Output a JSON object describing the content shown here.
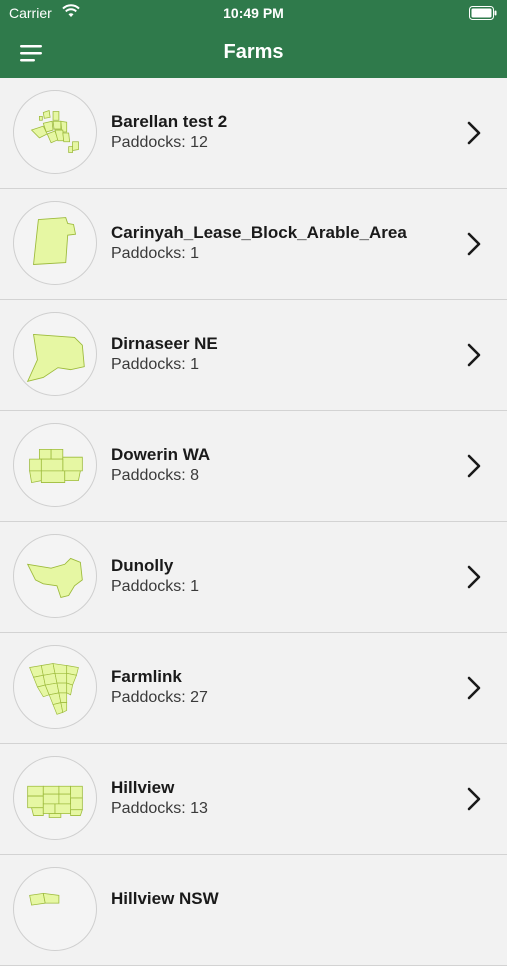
{
  "status_bar": {
    "carrier": "Carrier",
    "time": "10:49 PM",
    "icons": [
      "wifi-icon",
      "battery-icon"
    ]
  },
  "nav": {
    "title": "Farms",
    "menu_icon": "hamburger-menu-icon"
  },
  "colors": {
    "header": "#2f7a4b",
    "paddock_fill": "#e6f7a3",
    "paddock_stroke": "#9dbb3c"
  },
  "farms": [
    {
      "name": "Barellan test 2",
      "paddocks": "Paddocks: 12"
    },
    {
      "name": "Carinyah_Lease_Block_Arable_Area",
      "paddocks": "Paddocks: 1"
    },
    {
      "name": "Dirnaseer NE",
      "paddocks": "Paddocks: 1"
    },
    {
      "name": "Dowerin WA",
      "paddocks": "Paddocks: 8"
    },
    {
      "name": "Dunolly",
      "paddocks": "Paddocks: 1"
    },
    {
      "name": "Farmlink",
      "paddocks": "Paddocks: 27"
    },
    {
      "name": "Hillview",
      "paddocks": "Paddocks: 13"
    },
    {
      "name": "Hillview NSW",
      "paddocks": ""
    }
  ]
}
